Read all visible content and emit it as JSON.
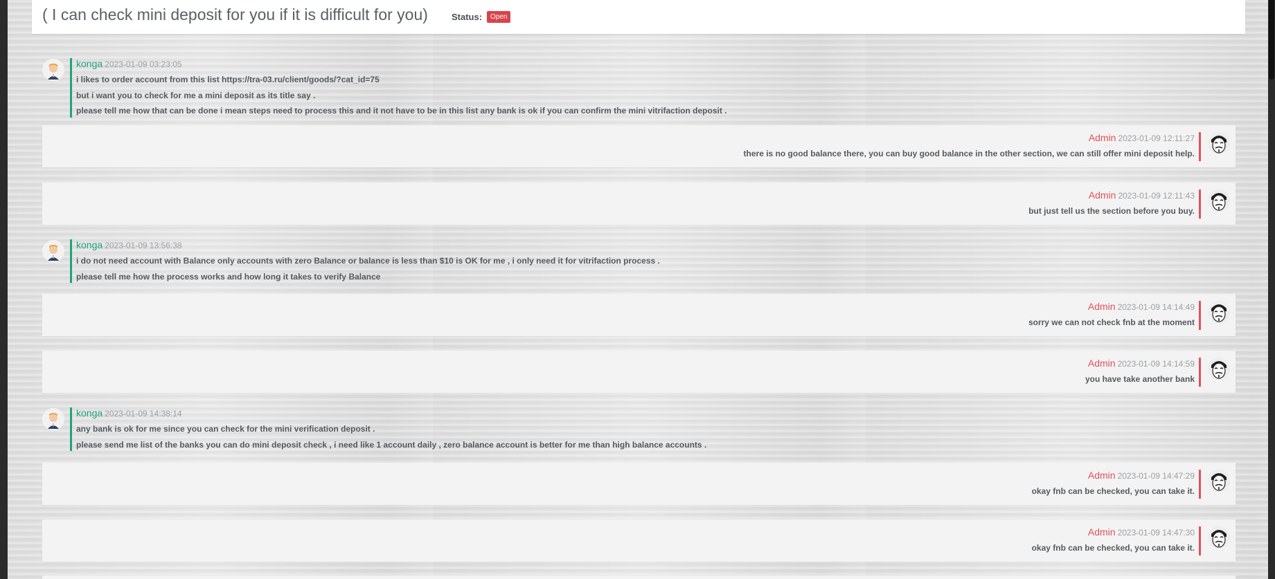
{
  "ticket": {
    "title": "( I can check mini deposit for you if it is difficult for you)",
    "status_label": "Status:",
    "status_value": "Open",
    "status_color": "#d9434b"
  },
  "messages": [
    {
      "author": "konga",
      "role": "user",
      "time": "2023-01-09 03:23:05",
      "lines": [
        "i likes to order account from this list https://tra-03.ru/client/goods/?cat_id=75",
        "but i want you to check for me a mini deposit as its title say .",
        "please tell me how that can be done i mean steps need to process this and it not have to be in this list any bank is ok if you can confirm the mini vitrifaction deposit ."
      ]
    },
    {
      "author": "Admin",
      "role": "admin",
      "time": "2023-01-09 12:11:27",
      "lines": [
        "there is no good balance there, you can buy good balance in the other section, we can still offer mini deposit help."
      ]
    },
    {
      "author": "Admin",
      "role": "admin",
      "time": "2023-01-09 12:11:43",
      "lines": [
        "but just tell us the section before you buy."
      ]
    },
    {
      "author": "konga",
      "role": "user",
      "time": "2023-01-09 13:56:38",
      "lines": [
        "i do not need account with Balance only accounts with zero Balance or balance is less than $10 is OK for me , i only need it for vitrifaction process .",
        "please tell me how the process works and how long it takes to verify Balance"
      ]
    },
    {
      "author": "Admin",
      "role": "admin",
      "time": "2023-01-09 14:14:49",
      "lines": [
        "sorry we can not check fnb at the moment"
      ]
    },
    {
      "author": "Admin",
      "role": "admin",
      "time": "2023-01-09 14:14:59",
      "lines": [
        "you have take another bank"
      ]
    },
    {
      "author": "konga",
      "role": "user",
      "time": "2023-01-09 14:38:14",
      "lines": [
        "any bank is ok for me since you can check for the mini verification deposit .",
        "please send me list of the banks you can do mini deposit check , i need like 1 account daily , zero balance account is better for me than high balance accounts ."
      ]
    },
    {
      "author": "Admin",
      "role": "admin",
      "time": "2023-01-09 14:47:29",
      "lines": [
        "okay fnb can be checked, you can take it."
      ]
    },
    {
      "author": "Admin",
      "role": "admin",
      "time": "2023-01-09 14:47:30",
      "lines": [
        "okay fnb can be checked, you can take it."
      ]
    }
  ],
  "colors": {
    "user_accent": "#1fa37f",
    "admin_accent": "#e0505c"
  },
  "icons": {
    "user_avatar": "cartoon-man-avatar-icon",
    "admin_avatar": "guy-fawkes-mask-avatar-icon"
  }
}
